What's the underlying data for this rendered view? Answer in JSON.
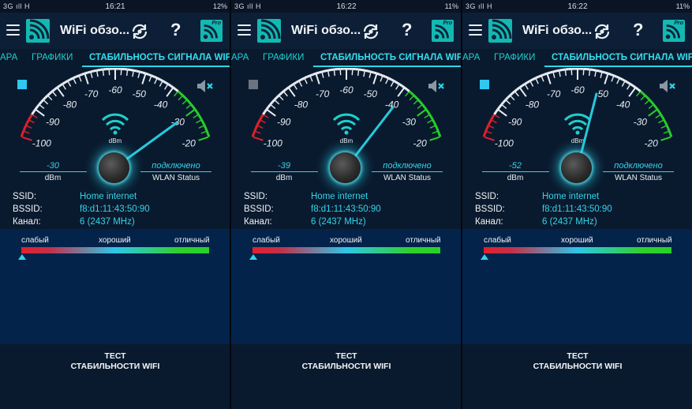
{
  "panels": [
    {
      "status": {
        "left": "3G ıll H",
        "time": "16:21",
        "battery": "12%"
      },
      "appbar": {
        "title": "WiFi обзо...",
        "help": "?",
        "pro_badge": "Pro"
      },
      "tabs": [
        {
          "label": "АРА"
        },
        {
          "label": "ГРАФИКИ"
        },
        {
          "label": "СТАБИЛЬНОСТЬ СИГНАЛА WIFI"
        }
      ],
      "gauge": {
        "ticks": [
          "-100",
          "-90",
          "-80",
          "-70",
          "-60",
          "-50",
          "-40",
          "-30",
          "-20"
        ],
        "unit": "dBm",
        "dbm_value": -30,
        "value_text": "-30",
        "value_label": "dBm",
        "status": "подключено",
        "status_label": "WLAN Status",
        "record_square": "active"
      },
      "info": {
        "ssid_label": "SSID:",
        "ssid": "Home internet",
        "bssid_label": "BSSID:",
        "bssid": "f8:d1:11:43:50:90",
        "channel_label": "Канал:",
        "channel": "6 (2437 MHz)"
      },
      "quality": {
        "weak": "слабый",
        "good": "хороший",
        "excellent": "отличный"
      },
      "button": {
        "line1": "ТЕСТ",
        "line2": "СТАБИЛЬНОСТИ WIFI"
      }
    },
    {
      "status": {
        "left": "3G ıll H",
        "time": "16:22",
        "battery": "11%"
      },
      "appbar": {
        "title": "WiFi обзо...",
        "help": "?",
        "pro_badge": "Pro"
      },
      "tabs": [
        {
          "label": "АРА"
        },
        {
          "label": "ГРАФИКИ"
        },
        {
          "label": "СТАБИЛЬНОСТЬ СИГНАЛА WIFI"
        }
      ],
      "gauge": {
        "ticks": [
          "-100",
          "-90",
          "-80",
          "-70",
          "-60",
          "-50",
          "-40",
          "-30",
          "-20"
        ],
        "unit": "dBm",
        "dbm_value": -39,
        "value_text": "-39",
        "value_label": "dBm",
        "status": "подключено",
        "status_label": "WLAN Status",
        "record_square": "inactive"
      },
      "info": {
        "ssid_label": "SSID:",
        "ssid": "Home internet",
        "bssid_label": "BSSID:",
        "bssid": "f8:d1:11:43:50:90",
        "channel_label": "Канал:",
        "channel": "6 (2437 MHz)"
      },
      "quality": {
        "weak": "слабый",
        "good": "хороший",
        "excellent": "отличный"
      },
      "button": {
        "line1": "ТЕСТ",
        "line2": "СТАБИЛЬНОСТИ WIFI"
      }
    },
    {
      "status": {
        "left": "3G ıll H",
        "time": "16:22",
        "battery": "11%"
      },
      "appbar": {
        "title": "WiFi обзо...",
        "help": "?",
        "pro_badge": "Pro"
      },
      "tabs": [
        {
          "label": "АРА"
        },
        {
          "label": "ГРАФИКИ"
        },
        {
          "label": "СТАБИЛЬНОСТЬ СИГНАЛА WIFI"
        }
      ],
      "gauge": {
        "ticks": [
          "-100",
          "-90",
          "-80",
          "-70",
          "-60",
          "-50",
          "-40",
          "-30",
          "-20"
        ],
        "unit": "dBm",
        "dbm_value": -52,
        "value_text": "-52",
        "value_label": "dBm",
        "status": "подключено",
        "status_label": "WLAN Status",
        "record_square": "active"
      },
      "info": {
        "ssid_label": "SSID:",
        "ssid": "Home internet",
        "bssid_label": "BSSID:",
        "bssid": "f8:d1:11:43:50:90",
        "channel_label": "Канал:",
        "channel": "6 (2437 MHz)"
      },
      "quality": {
        "weak": "слабый",
        "good": "хороший",
        "excellent": "отличный"
      },
      "button": {
        "line1": "ТЕСТ",
        "line2": "СТАБИЛЬНОСТИ WIFI"
      }
    }
  ],
  "colors": {
    "accent": "#33d4ea",
    "gauge_red": "#e2202a",
    "gauge_green": "#27d12a",
    "logo": "#13b8b3"
  }
}
